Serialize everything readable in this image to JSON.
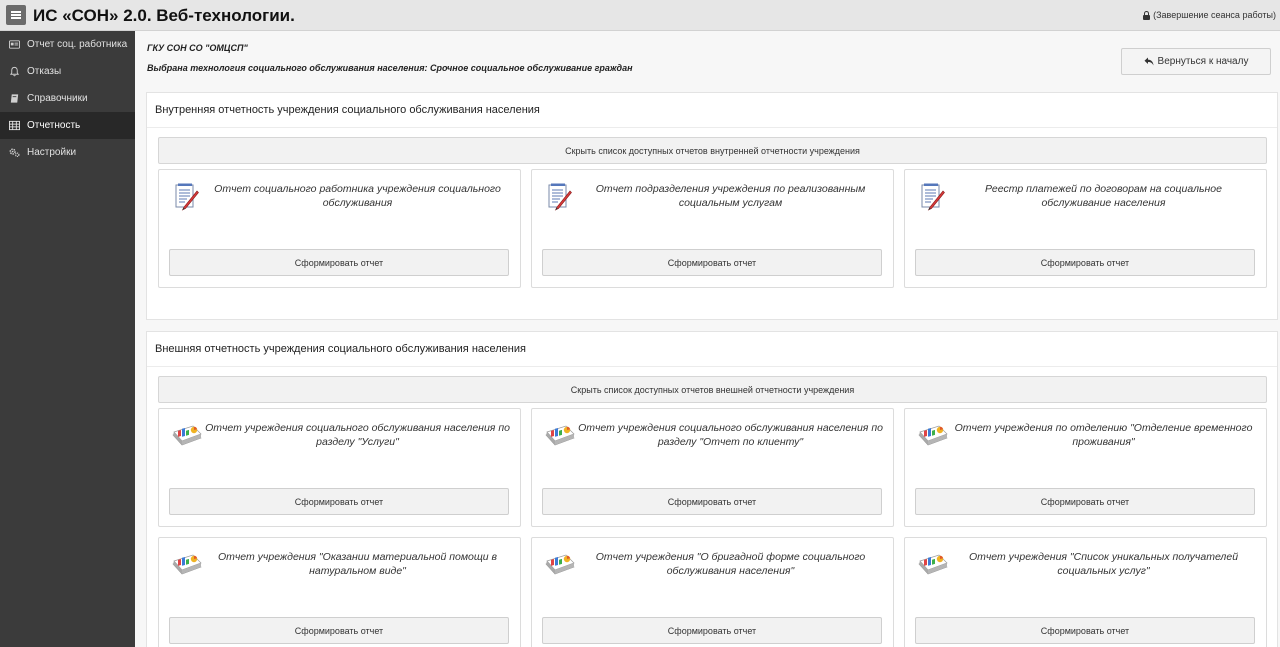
{
  "header": {
    "title": "ИС «СОН» 2.0. Веб-технологии.",
    "logout": "(Завершение сеанса работы)"
  },
  "sidebar": {
    "items": [
      {
        "label": "Отчет соц. работника",
        "icon": "id-card-icon"
      },
      {
        "label": "Отказы",
        "icon": "bell-icon"
      },
      {
        "label": "Справочники",
        "icon": "book-icon"
      },
      {
        "label": "Отчетность",
        "icon": "table-icon"
      },
      {
        "label": "Настройки",
        "icon": "gears-icon"
      }
    ],
    "active_index": 3
  },
  "main": {
    "org": "ГКУ СОН СО \"ОМЦСП\"",
    "technology": "Выбрана технология социального обслуживания населения: Срочное социальное обслуживание граждан",
    "back_button": "Вернуться к началу",
    "panels": [
      {
        "title": "Внутренняя отчетность учреждения социального обслуживания населения",
        "toggle": "Скрыть список доступных отчетов внутренней отчетности учреждения",
        "icon": "document-pen-icon",
        "cards": [
          {
            "title": "Отчет социального работника учреждения социального обслуживания",
            "button": "Сформировать отчет"
          },
          {
            "title": "Отчет подразделения учреждения по реализованным социальным услугам",
            "button": "Сформировать отчет"
          },
          {
            "title": "Реестр платежей по договорам на социальное обслуживание населения",
            "button": "Сформировать отчет"
          }
        ]
      },
      {
        "title": "Внешняя отчетность учреждения социального обслуживания населения",
        "toggle": "Скрыть список доступных отчетов внешней отчетности учреждения",
        "icon": "report-chart-icon",
        "cards": [
          {
            "title": "Отчет учреждения социального обслуживания населения по разделу \"Услуги\"",
            "button": "Сформировать отчет"
          },
          {
            "title": "Отчет учреждения социального обслуживания населения по разделу \"Отчет по клиенту\"",
            "button": "Сформировать отчет"
          },
          {
            "title": "Отчет учреждения по отделению \"Отделение временного проживания\"",
            "button": "Сформировать отчет"
          },
          {
            "title": "Отчет учреждения \"Оказании материальной помощи в натуральном виде\"",
            "button": "Сформировать отчет"
          },
          {
            "title": "Отчет учреждения \"О бригадной форме социального обслуживания населения\"",
            "button": "Сформировать отчет"
          },
          {
            "title": "Отчет учреждения \"Список уникальных получателей социальных услуг\"",
            "button": "Сформировать отчет"
          }
        ]
      }
    ]
  }
}
